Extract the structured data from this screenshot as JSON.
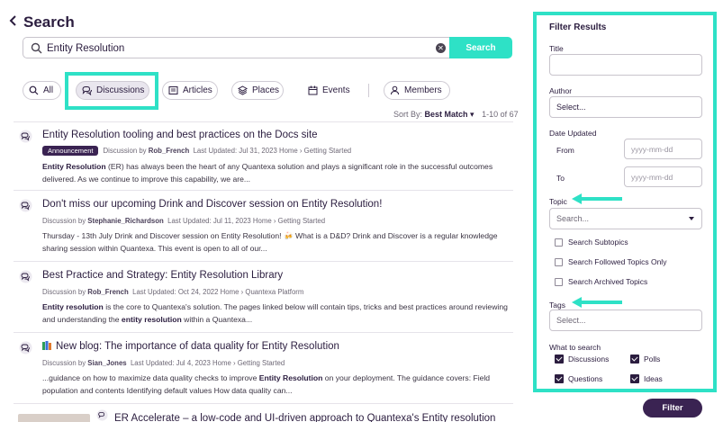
{
  "header": {
    "title": "Search",
    "back_icon": "chevron-left-icon"
  },
  "search": {
    "value": "Entity Resolution",
    "button_label": "Search"
  },
  "tabs": [
    {
      "label": "All",
      "icon": "search-icon"
    },
    {
      "label": "Discussions",
      "icon": "discussion-icon",
      "active": true
    },
    {
      "label": "Articles",
      "icon": "article-icon"
    },
    {
      "label": "Places",
      "icon": "places-icon"
    },
    {
      "label": "Events",
      "icon": "calendar-icon"
    },
    {
      "label": "Members",
      "icon": "person-icon"
    }
  ],
  "sort": {
    "label": "Sort By:",
    "value": "Best Match",
    "count": "1-10 of 67"
  },
  "results": [
    {
      "title": "Entity Resolution tooling and best practices on the Docs site",
      "badge": "Announcement",
      "meta_pre": "Discussion by",
      "author": "Rob_French",
      "meta_post": "Last Updated: Jul 31, 2023   Home › Getting Started",
      "snippet_bold": "Entity Resolution",
      "snippet": " (ER) has always been the heart of any Quantexa solution and plays a significant role in the successful outcomes delivered.   As we continue to improve this capability, we are..."
    },
    {
      "title": "Don't miss our upcoming Drink and Discover session on Entity Resolution!",
      "meta_pre": "Discussion by",
      "author": "Stephanie_Richardson",
      "meta_post": "Last Updated: Jul 11, 2023   Home › Getting Started",
      "snippet": "Thursday - 13th July Drink and Discover session on Entity Resolution! 🍻 What is a D&D? Drink and Discover is a regular knowledge sharing session within Quantexa. This event is open to all of our..."
    },
    {
      "title": "Best Practice and Strategy: Entity Resolution Library",
      "meta_pre": "Discussion by",
      "author": "Rob_French",
      "meta_post": "Last Updated: Oct 24, 2022   Home › Quantexa Platform",
      "snippet_bold": "Entity resolution",
      "snippet": " is the core to Quantexa's solution. The pages linked below will contain tips, tricks and best practices around reviewing and understanding the ",
      "snippet_bold2": "entity resolution",
      "snippet2": " within a Quantexa..."
    },
    {
      "title": "New blog: The importance of data quality for Entity Resolution",
      "meta_pre": "Discussion by",
      "author": "Sian_Jones",
      "meta_post": "Last Updated: Jul 4, 2023   Home › Getting Started",
      "snippet": "...guidance on how to maximize data quality checks to improve ",
      "snippet_bold": "Entity Resolution",
      "snippet2": " on your deployment. The guidance covers: Field population and contents Identifying default values How data quality can..."
    },
    {
      "title": "ER Accelerate – a low-code and UI-driven approach to Quantexa's Entity resolution"
    }
  ],
  "filter": {
    "title": "Filter Results",
    "title_label": "Title",
    "author_label": "Author",
    "author_placeholder": "Select...",
    "date_label": "Date Updated",
    "from_label": "From",
    "to_label": "To",
    "date_placeholder": "yyyy-mm-dd",
    "topic_label": "Topic",
    "topic_placeholder": "Search...",
    "checks": [
      "Search Subtopics",
      "Search Followed Topics Only",
      "Search Archived Topics"
    ],
    "tags_label": "Tags",
    "tags_placeholder": "Select...",
    "what_label": "What to search",
    "what_items": [
      "Discussions",
      "Polls",
      "Questions",
      "Ideas"
    ],
    "button": "Filter"
  },
  "colors": {
    "accent": "#2ee1c6",
    "brand": "#3a2352",
    "text": "#2b1d3f"
  }
}
